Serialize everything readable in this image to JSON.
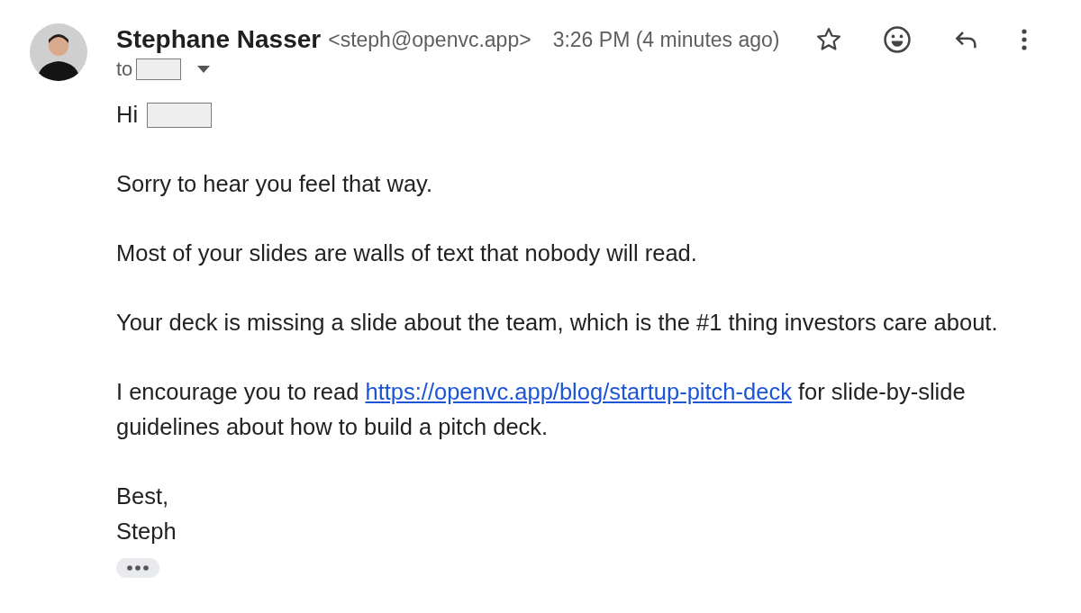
{
  "sender": {
    "name": "Stephane Nasser",
    "email": "<steph@openvc.app>",
    "time": "3:26 PM (4 minutes ago)",
    "starred": false
  },
  "recipient": {
    "label": "to"
  },
  "greeting": "Hi",
  "paragraphs": [
    {
      "kind": "text",
      "text": "Sorry to hear you feel that way."
    },
    {
      "kind": "text",
      "text": "Most of your slides are walls of text that nobody will read."
    },
    {
      "kind": "text",
      "text": "Your deck is missing a slide about the team, which is the #1 thing investors care about."
    },
    {
      "kind": "link",
      "text": "I encourage you to read ",
      "link": "https://openvc.app/blog/startup-pitch-deck",
      "after": " for slide-by-slide guidelines about how to build a pitch deck."
    }
  ],
  "signoff": [
    "Best,",
    "Steph"
  ]
}
